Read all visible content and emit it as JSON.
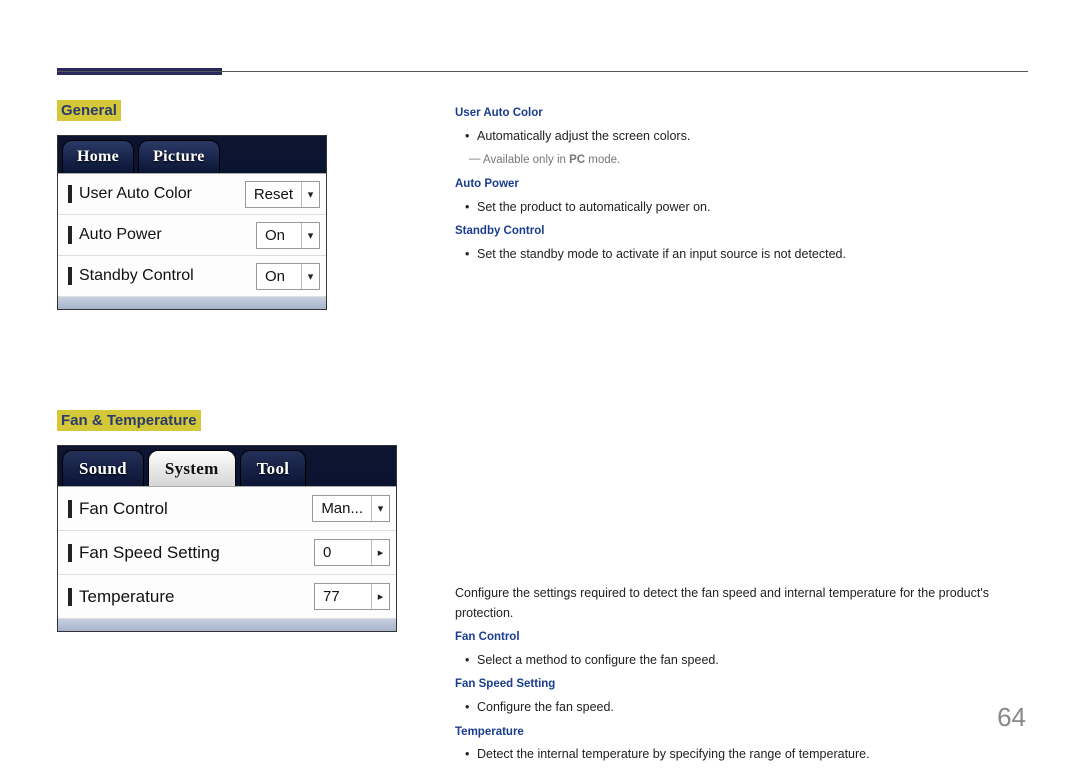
{
  "page_number": "64",
  "sections": {
    "general": {
      "title": "General",
      "screenshot": {
        "tabs": [
          "Home",
          "Picture"
        ],
        "rows": [
          {
            "label": "User Auto Color",
            "value": "Reset",
            "caret": "▾"
          },
          {
            "label": "Auto Power",
            "value": "On",
            "caret": "▾"
          },
          {
            "label": "Standby Control",
            "value": "On",
            "caret": "▾"
          }
        ]
      },
      "items": [
        {
          "heading": "User Auto Color",
          "bullets": [
            "Automatically adjust the screen colors."
          ],
          "note_prefix": "Available only in ",
          "note_bold": "PC",
          "note_suffix": " mode."
        },
        {
          "heading": "Auto Power",
          "bullets": [
            "Set the product to automatically power on."
          ]
        },
        {
          "heading": "Standby Control",
          "bullets": [
            "Set the standby mode to activate if an input source is not detected."
          ]
        }
      ]
    },
    "fan": {
      "title": "Fan & Temperature",
      "intro": "Configure the settings required to detect the fan speed and internal temperature for the product's protection.",
      "screenshot": {
        "tabs": [
          "Sound",
          "System",
          "Tool"
        ],
        "active_tab": 1,
        "rows": [
          {
            "label": "Fan Control",
            "value": "Man...",
            "caret": "▾"
          },
          {
            "label": "Fan Speed Setting",
            "value": "0",
            "caret": "▸"
          },
          {
            "label": "Temperature",
            "value": "77",
            "caret": "▸"
          }
        ]
      },
      "items": [
        {
          "heading": "Fan Control",
          "bullets": [
            "Select a method to configure the fan speed."
          ]
        },
        {
          "heading": "Fan Speed Setting",
          "bullets": [
            "Configure the fan speed."
          ]
        },
        {
          "heading": "Temperature",
          "bullets": [
            "Detect the internal temperature by specifying the range of temperature."
          ]
        }
      ]
    }
  }
}
